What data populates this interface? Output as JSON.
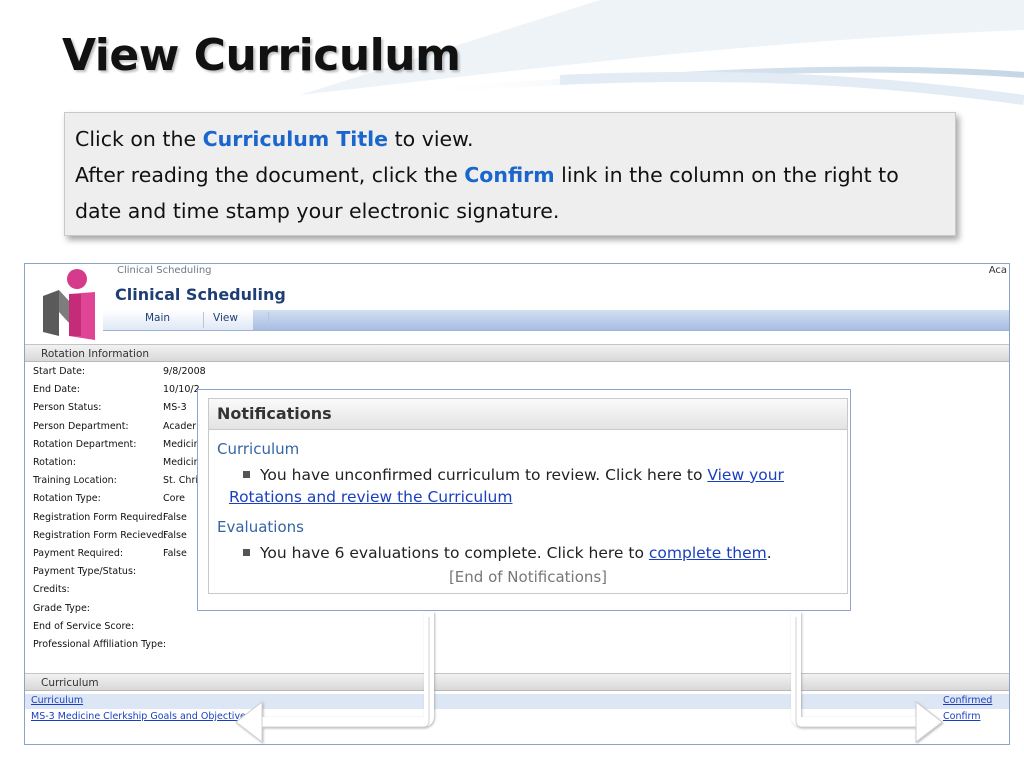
{
  "slide": {
    "title": "View Curriculum",
    "callout": {
      "line1_pre": "Click on the ",
      "line1_hl": "Curriculum Title",
      "line1_post": " to view.",
      "line2_pre": "After reading the document, click the ",
      "line2_hl": "Confirm",
      "line2_post": " link in the column on the right to date and time stamp your electronic signature."
    }
  },
  "app": {
    "top_small": "Clinical Scheduling",
    "right_label": "Aca",
    "title": "Clinical Scheduling",
    "nav": [
      "Main",
      "View"
    ],
    "rotation_section": "Rotation Information",
    "rotation_info": [
      {
        "label": "Start Date:",
        "value": "9/8/2008"
      },
      {
        "label": "End Date:",
        "value": "10/10/2"
      },
      {
        "label": "Person Status:",
        "value": "MS-3"
      },
      {
        "label": "Person Department:",
        "value": "Acader"
      },
      {
        "label": "Rotation Department:",
        "value": "Medicin"
      },
      {
        "label": "Rotation:",
        "value": "Medicin"
      },
      {
        "label": "Training Location:",
        "value": "St. Chri"
      },
      {
        "label": "Rotation Type:",
        "value": "Core"
      },
      {
        "label": "Registration Form Required:",
        "value": "False"
      },
      {
        "label": "Registration Form Recieved:",
        "value": "False"
      },
      {
        "label": "Payment Required:",
        "value": "False"
      },
      {
        "label": "Payment Type/Status:",
        "value": ""
      },
      {
        "label": "Credits:",
        "value": ""
      },
      {
        "label": "Grade Type:",
        "value": ""
      },
      {
        "label": "End of Service Score:",
        "value": ""
      },
      {
        "label": "Professional Affiliation Type:",
        "value": ""
      }
    ],
    "curriculum_section": "Curriculum",
    "curriculum_header": {
      "left": "Curriculum",
      "right": "Confirmed"
    },
    "curriculum_rows": [
      {
        "title": "MS-3 Medicine Clerkship Goals and Objectives",
        "action": "Confirm"
      }
    ]
  },
  "notifications": {
    "title": "Notifications",
    "curriculum_heading": "Curriculum",
    "curriculum_text": "You have unconfirmed curriculum to review. Click here to ",
    "curriculum_link": "View your Rotations and review the Curriculum",
    "evaluations_heading": "Evaluations",
    "evaluations_text": "You have 6 evaluations to complete. Click here to ",
    "evaluations_link": "complete them",
    "evaluations_tail": ".",
    "end": "[End of Notifications]"
  }
}
